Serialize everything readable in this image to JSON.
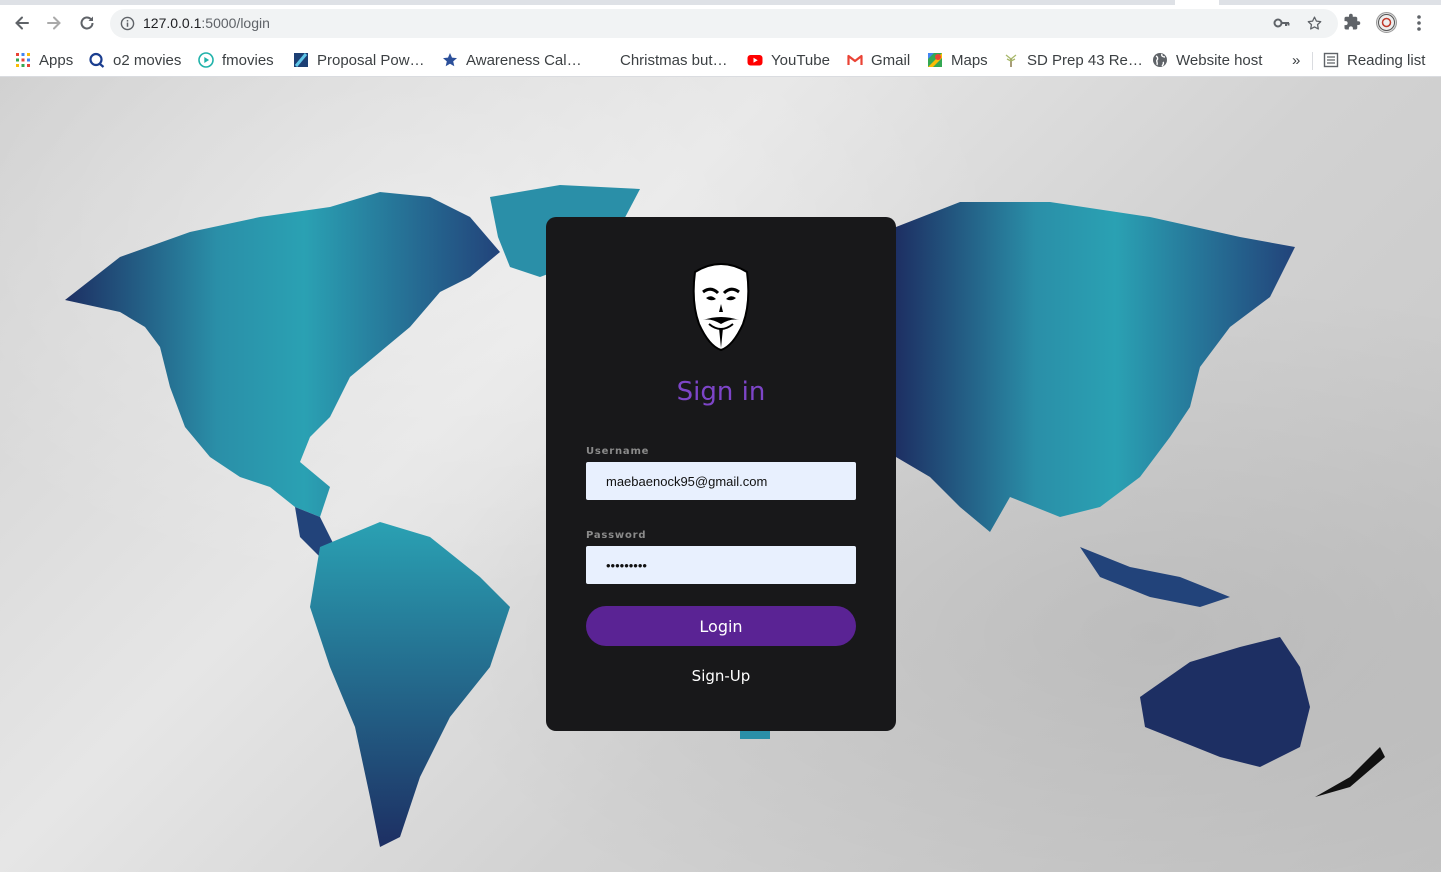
{
  "browser": {
    "url_host": "127.0.0.1",
    "url_path": ":5000/login",
    "bookmarks": [
      {
        "label": "Apps",
        "icon": "apps-grid-icon"
      },
      {
        "label": "o2 movies",
        "icon": "o2-icon"
      },
      {
        "label": "fmovies",
        "icon": "play-icon"
      },
      {
        "label": "Proposal Pow…",
        "icon": "doc-icon"
      },
      {
        "label": "Awareness Cal…",
        "icon": "star-icon"
      },
      {
        "label": "Christmas but…",
        "icon": ""
      },
      {
        "label": "YouTube",
        "icon": "youtube-icon"
      },
      {
        "label": "Gmail",
        "icon": "gmail-icon"
      },
      {
        "label": "Maps",
        "icon": "maps-icon"
      },
      {
        "label": "SD Prep 43 Re…",
        "icon": "tree-icon"
      },
      {
        "label": "Website host",
        "icon": "globe-icon"
      }
    ],
    "more_label": "»",
    "reading_list_label": "Reading list"
  },
  "login": {
    "title": "Sign in",
    "username_label": "Username",
    "username_value": "maebaenock95@gmail.com",
    "password_label": "Password",
    "password_value": "password1",
    "login_button": "Login",
    "signup_link": "Sign-Up"
  },
  "colors": {
    "card_bg": "#18181a",
    "title": "#7d45c8",
    "button": "#5a2394",
    "input_bg": "#e8f0fe",
    "map_dark": "#1d2f63",
    "map_light": "#2aa1b3"
  }
}
